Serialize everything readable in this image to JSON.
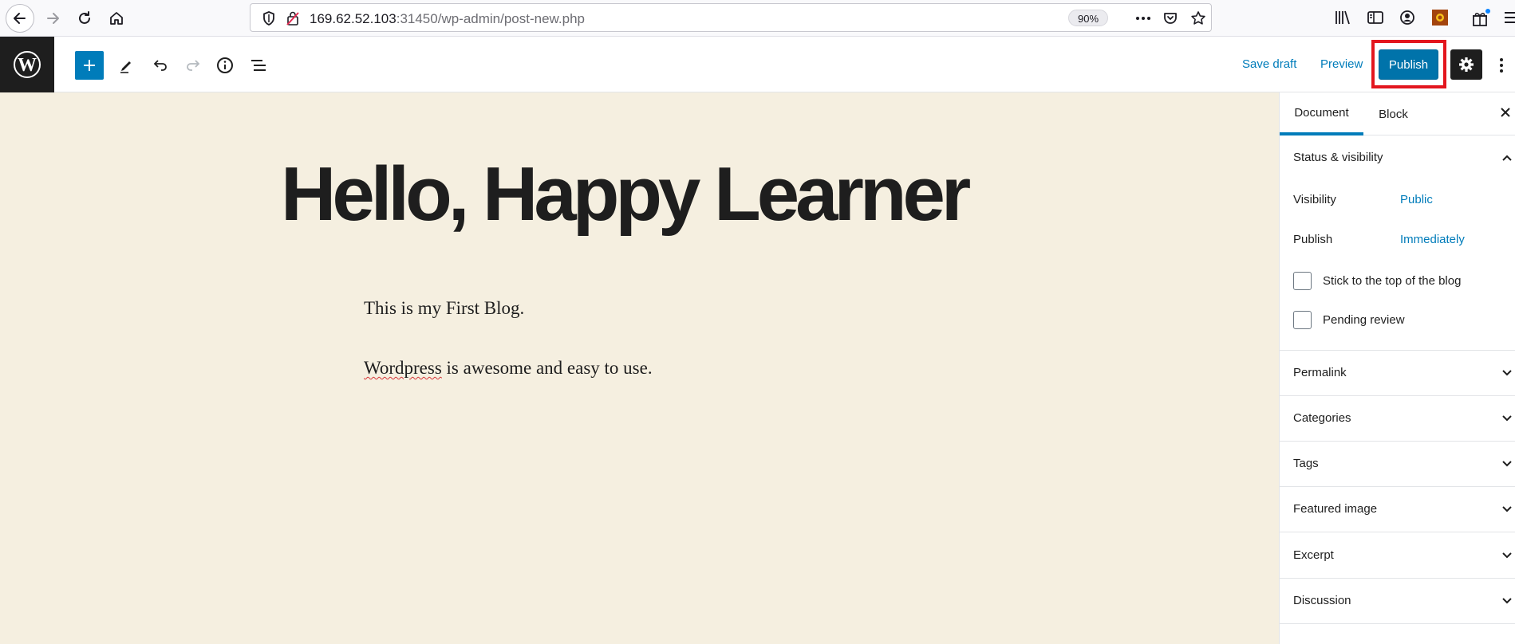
{
  "browser": {
    "url_host": "169.62.52.103",
    "url_rest": ":31450/wp-admin/post-new.php",
    "zoom": "90%",
    "icons": [
      "back-icon",
      "forward-icon",
      "reload-icon",
      "home-icon",
      "shield-icon",
      "insecure-lock-icon",
      "more-actions-icon",
      "pocket-icon",
      "bookmark-star-icon",
      "library-icon",
      "sidebar-icon",
      "account-icon",
      "extension-icon",
      "gift-icon",
      "menu-icon"
    ]
  },
  "editor_header": {
    "save_draft": "Save draft",
    "preview": "Preview",
    "publish": "Publish",
    "icons": [
      "wordpress-logo-icon",
      "add-block-icon",
      "edit-tools-icon",
      "undo-icon",
      "redo-icon",
      "info-icon",
      "outline-icon",
      "settings-gear-icon",
      "more-vertical-icon"
    ],
    "accent_color": "#007cba",
    "highlight_color": "#e3161e"
  },
  "post": {
    "title": "Hello, Happy Learner",
    "paragraph_1": "This is my First Blog.",
    "paragraph_2_misspelled": "Wordpress",
    "paragraph_2_rest": " is awesome and easy to use.",
    "canvas_color": "#f5efe0"
  },
  "sidebar": {
    "tab_document": "Document",
    "tab_block": "Block",
    "status_visibility": "Status & visibility",
    "visibility_label": "Visibility",
    "visibility_value": "Public",
    "publish_label": "Publish",
    "publish_value": "Immediately",
    "stick_top": "Stick to the top of the blog",
    "pending_review": "Pending review",
    "panels": {
      "permalink": "Permalink",
      "categories": "Categories",
      "tags": "Tags",
      "featured_image": "Featured image",
      "excerpt": "Excerpt",
      "discussion": "Discussion"
    }
  }
}
